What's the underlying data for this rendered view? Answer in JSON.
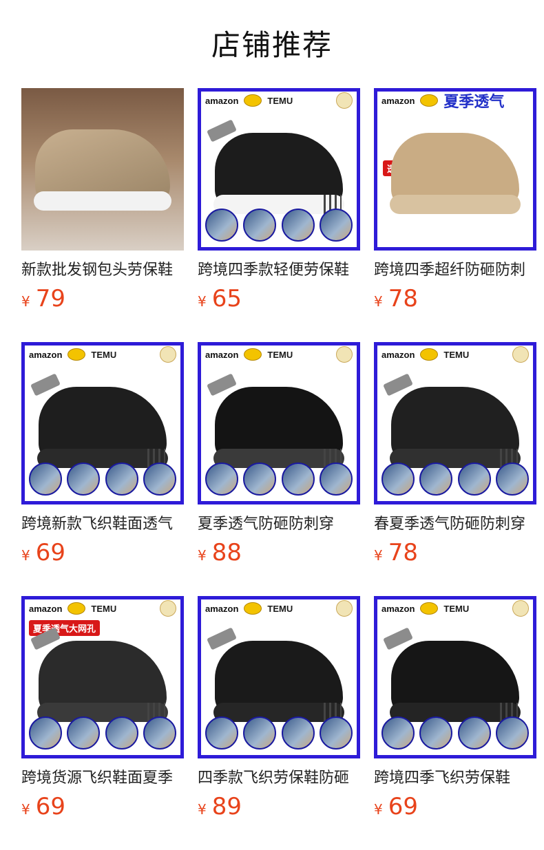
{
  "section_title": "店铺推荐",
  "currency_symbol": "¥",
  "products": [
    {
      "name": "新款批发钢包头劳保鞋",
      "price": "79",
      "style": "photo"
    },
    {
      "name": "跨境四季款轻便劳保鞋",
      "price": "65",
      "style": "blue",
      "shoe_color": "#1c1c1c",
      "sole_color": "#f4f4f4"
    },
    {
      "name": "跨境四季超纤防砸防刺",
      "price": "78",
      "style": "blue-summer",
      "banner_text": "夏季透气",
      "badge": "透气大网眼",
      "shoe_color": "#c9ac84",
      "sole_color": "#d8c2a0"
    },
    {
      "name": "跨境新款飞织鞋面透气",
      "price": "69",
      "style": "blue",
      "shoe_color": "#1e1e1e",
      "sole_color": "#2a2a2a"
    },
    {
      "name": "夏季透气防砸防刺穿",
      "price": "88",
      "style": "blue",
      "shoe_color": "#141414",
      "sole_color": "#3a3a3a"
    },
    {
      "name": "春夏季透气防砸防刺穿",
      "price": "78",
      "style": "blue",
      "shoe_color": "#202020",
      "sole_color": "#303030"
    },
    {
      "name": "跨境货源飞织鞋面夏季",
      "price": "69",
      "style": "blue-tag",
      "badge": "夏季透气大网孔",
      "shoe_color": "#2b2b2b",
      "sole_color": "#3a3a3a"
    },
    {
      "name": "四季款飞织劳保鞋防砸",
      "price": "89",
      "style": "blue",
      "shoe_color": "#1a1a1a",
      "sole_color": "#262626"
    },
    {
      "name": "跨境四季飞织劳保鞋",
      "price": "69",
      "style": "blue",
      "shoe_color": "#161616",
      "sole_color": "#242424"
    }
  ],
  "banner": {
    "amazon": "amazon",
    "temu": "TEMU"
  }
}
